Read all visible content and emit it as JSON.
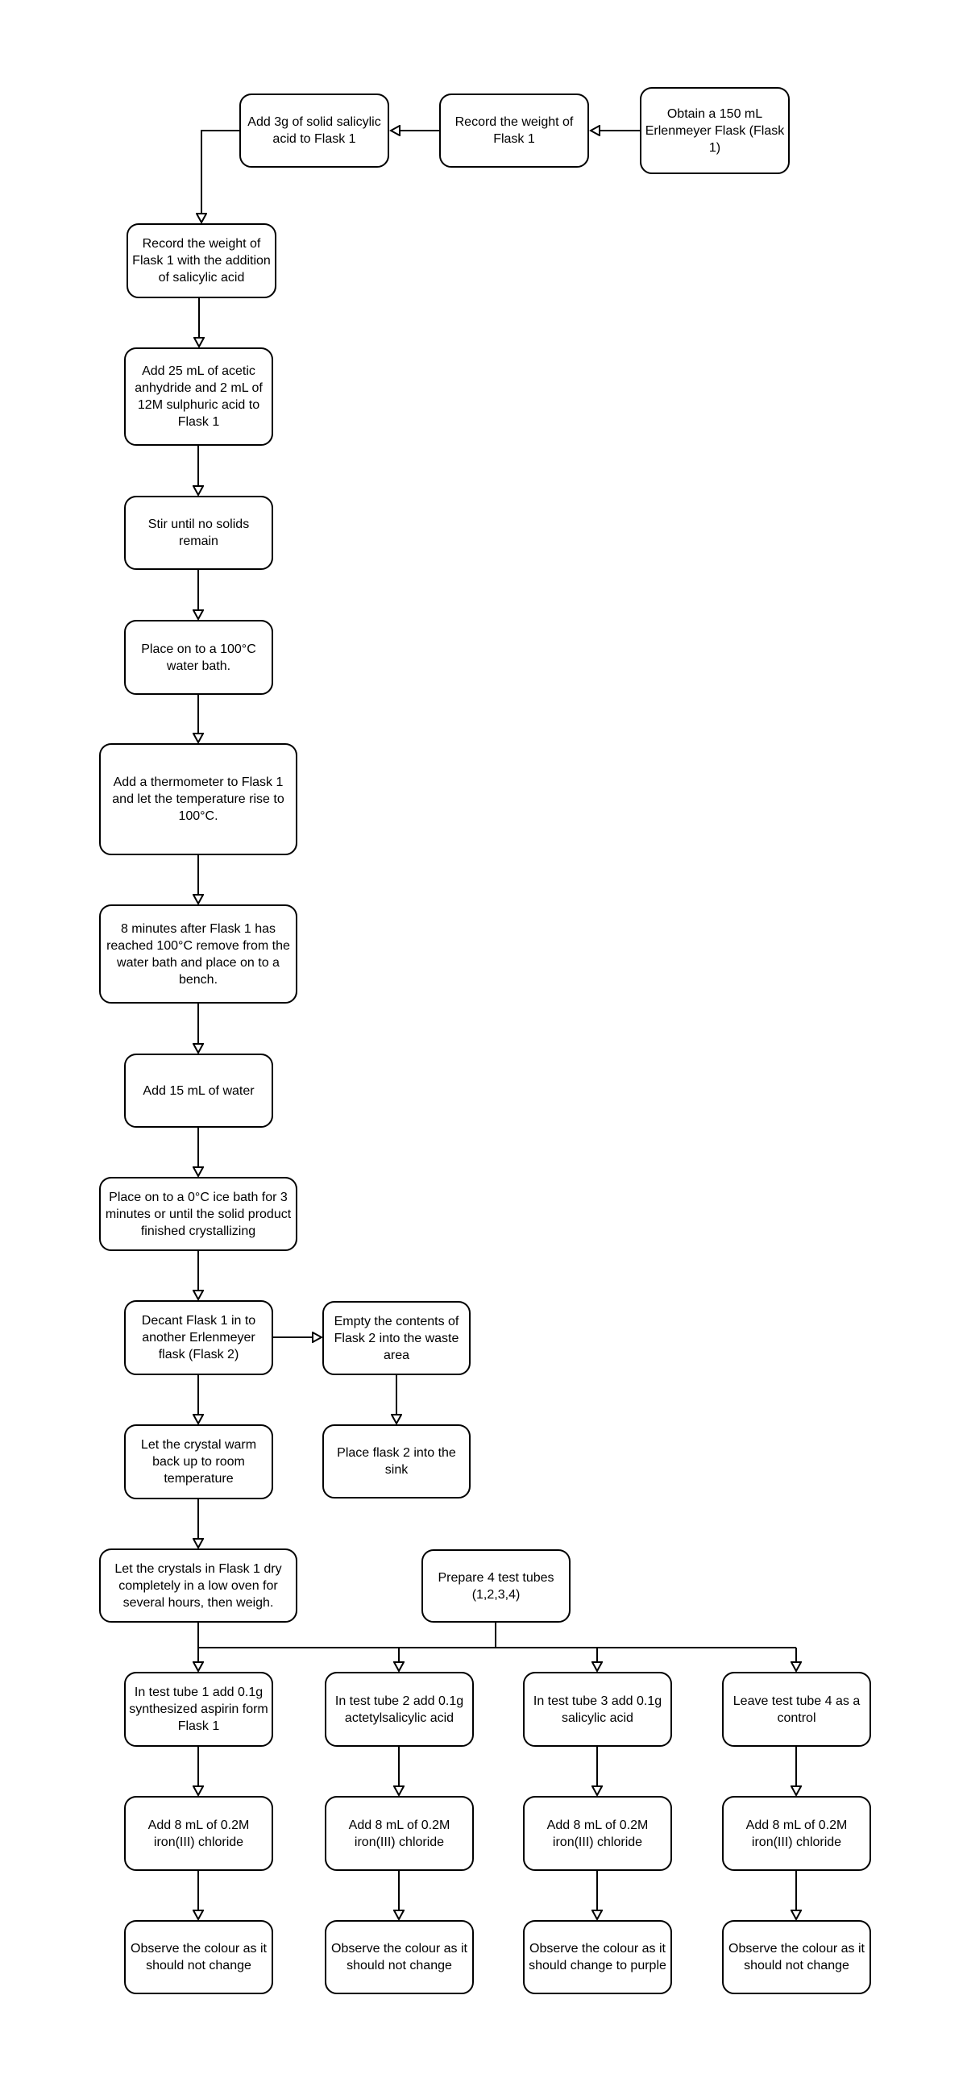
{
  "diagram": {
    "type": "flowchart",
    "line_color": "#000000",
    "box_fill": "#ffffff",
    "nodes": {
      "obtain_flask": "Obtain a 150 mL Erlenmeyer Flask (Flask 1)",
      "record_weight": "Record the weight  of Flask 1",
      "add_salicylic": "Add 3g  of solid salicylic acid to Flask 1",
      "record_weight_salicylic": "Record the weight of Flask 1 with the addition of salicylic acid",
      "add_acetic": "Add 25 mL of acetic anhydride and 2 mL of 12M sulphuric acid to Flask 1",
      "stir": "Stir until no solids remain",
      "water_bath": "Place on to a 100°C water bath.",
      "thermometer": "Add a thermometer to Flask 1 and let the temperature rise to 100°C.",
      "remove_bench": "8 minutes after Flask 1 has reached 100°C remove from the water bath and place on to a bench.",
      "add_water": "Add 15 mL of water",
      "ice_bath": "Place on to a 0°C ice bath for 3 minutes or until the solid product finished crystallizing",
      "decant": "Decant Flask 1 in to another Erlenmeyer flask (Flask 2)",
      "empty_waste": "Empty the contents of Flask 2 into the waste area",
      "sink": "Place flask 2 into the sink",
      "warm_room": "Let the crystal warm back up to room temperature",
      "dry_weigh": "Let the crystals in Flask 1 dry completely in a low oven for several hours, then weigh.",
      "prepare_tubes": "Prepare 4 test tubes (1,2,3,4)",
      "tube1_add": "In test tube 1 add 0.1g synthesized aspirin form Flask 1",
      "tube2_add": "In test tube 2 add 0.1g actetylsalicylic acid",
      "tube3_add": "In test tube 3 add 0.1g salicylic acid",
      "tube4_control": "Leave test tube 4 as a control",
      "tube1_fecl3": "Add 8 mL of 0.2M iron(III) chloride",
      "tube2_fecl3": "Add 8 mL of 0.2M iron(III) chloride",
      "tube3_fecl3": "Add 8 mL of 0.2M iron(III) chloride",
      "tube4_fecl3": "Add 8 mL of 0.2M iron(III) chloride",
      "tube1_observe": "Observe the colour as it should not change",
      "tube2_observe": "Observe the colour as it should not change",
      "tube3_observe": "Observe the colour as it should change to purple",
      "tube4_observe": "Observe the colour as it should not change"
    },
    "edges": [
      [
        "obtain_flask",
        "record_weight"
      ],
      [
        "record_weight",
        "add_salicylic"
      ],
      [
        "add_salicylic",
        "record_weight_salicylic"
      ],
      [
        "record_weight_salicylic",
        "add_acetic"
      ],
      [
        "add_acetic",
        "stir"
      ],
      [
        "stir",
        "water_bath"
      ],
      [
        "water_bath",
        "thermometer"
      ],
      [
        "thermometer",
        "remove_bench"
      ],
      [
        "remove_bench",
        "add_water"
      ],
      [
        "add_water",
        "ice_bath"
      ],
      [
        "ice_bath",
        "decant"
      ],
      [
        "decant",
        "empty_waste"
      ],
      [
        "empty_waste",
        "sink"
      ],
      [
        "decant",
        "warm_room"
      ],
      [
        "warm_room",
        "dry_weigh"
      ],
      [
        "dry_weigh",
        "tube1_add"
      ],
      [
        "prepare_tubes",
        "tube1_add"
      ],
      [
        "prepare_tubes",
        "tube2_add"
      ],
      [
        "prepare_tubes",
        "tube3_add"
      ],
      [
        "prepare_tubes",
        "tube4_control"
      ],
      [
        "tube1_add",
        "tube1_fecl3"
      ],
      [
        "tube2_add",
        "tube2_fecl3"
      ],
      [
        "tube3_add",
        "tube3_fecl3"
      ],
      [
        "tube4_control",
        "tube4_fecl3"
      ],
      [
        "tube1_fecl3",
        "tube1_observe"
      ],
      [
        "tube2_fecl3",
        "tube2_observe"
      ],
      [
        "tube3_fecl3",
        "tube3_observe"
      ],
      [
        "tube4_fecl3",
        "tube4_observe"
      ]
    ]
  }
}
